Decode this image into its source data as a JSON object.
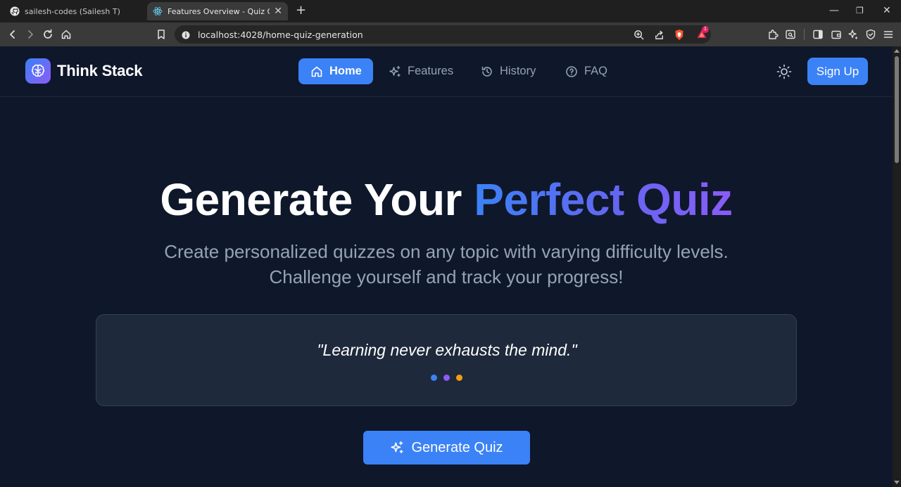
{
  "browser": {
    "tabs": [
      {
        "title": "sailesh-codes (Sailesh T)",
        "icon": "github-icon",
        "active": false
      },
      {
        "title": "Features Overview - Quiz Genera",
        "icon": "react-icon",
        "active": true
      }
    ],
    "new_tab": "+",
    "window_controls": {
      "minimize": "—",
      "restore": "❐",
      "close": "✕"
    },
    "url": "localhost:4028/home-quiz-generation",
    "notification_count": "1"
  },
  "navbar": {
    "brand": "Think Stack",
    "items": [
      {
        "label": "Home",
        "icon": "home-icon",
        "active": true
      },
      {
        "label": "Features",
        "icon": "sparkles-icon",
        "active": false
      },
      {
        "label": "History",
        "icon": "history-icon",
        "active": false
      },
      {
        "label": "FAQ",
        "icon": "help-circle-icon",
        "active": false
      }
    ],
    "signup_label": "Sign Up"
  },
  "hero": {
    "title_plain": "Generate Your ",
    "title_highlight": "Perfect Quiz",
    "subtitle": "Create personalized quizzes on any topic with varying difficulty levels. Challenge yourself and track your progress!"
  },
  "quote": {
    "text": "\"Learning never exhausts the mind.\"",
    "dot_colors": [
      "#3b82f6",
      "#8b5cf6",
      "#f59e0b"
    ]
  },
  "cta": {
    "label": "Generate Quiz"
  },
  "colors": {
    "background": "#0f172a",
    "accent": "#3b82f6",
    "accent_purple": "#8b5cf6",
    "card": "#1e293b"
  }
}
